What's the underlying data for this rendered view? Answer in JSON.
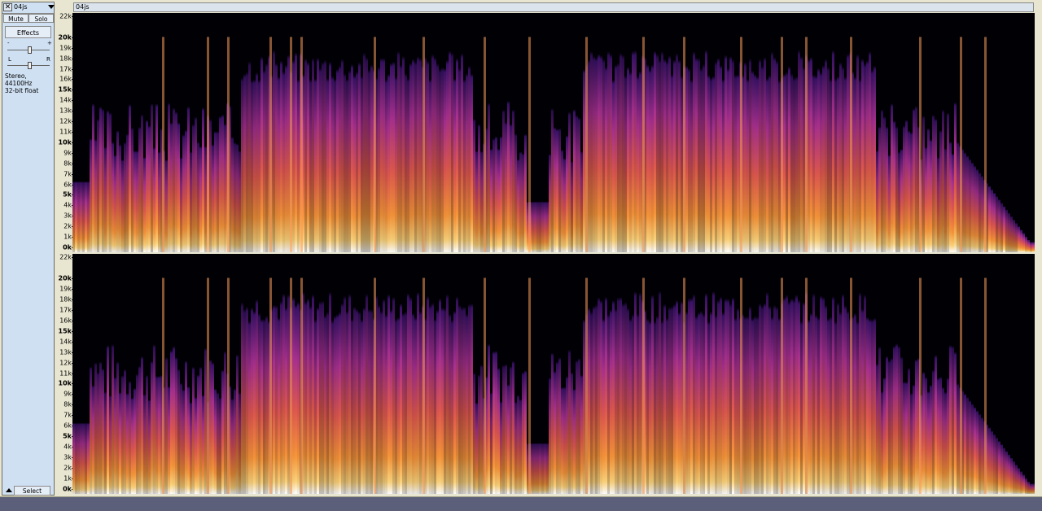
{
  "track": {
    "name": "04js",
    "mute_label": "Mute",
    "solo_label": "Solo",
    "effects_label": "Effects",
    "gain_minus": "-",
    "gain_plus": "+",
    "pan_left": "L",
    "pan_right": "R",
    "format_line1": "Stereo, 44100Hz",
    "format_line2": "32-bit float",
    "select_label": "Select",
    "close_glyph": "✕"
  },
  "clip": {
    "name": "04js"
  },
  "axis": {
    "labels": [
      "22k",
      "20k",
      "19k",
      "18k",
      "17k",
      "16k",
      "15k",
      "14k",
      "13k",
      "12k",
      "11k",
      "10k",
      "9k",
      "8k",
      "7k",
      "6k",
      "5k",
      "4k",
      "3k",
      "2k",
      "1k",
      "0k"
    ],
    "values": [
      22,
      20,
      19,
      18,
      17,
      16,
      15,
      14,
      13,
      12,
      11,
      10,
      9,
      8,
      7,
      6,
      5,
      4,
      3,
      2,
      1,
      0
    ],
    "bold": [
      "20k",
      "15k",
      "10k",
      "5k",
      "0k"
    ]
  },
  "colors": {
    "panel": "#cfe0f3",
    "frame": "#e8e6d0",
    "spectrogram_scale": [
      "#000005",
      "#1c0b3c",
      "#4a1478",
      "#8a2a9c",
      "#c43c8a",
      "#ec6a4a",
      "#f9a43c",
      "#fde08a",
      "#ffffff"
    ]
  }
}
